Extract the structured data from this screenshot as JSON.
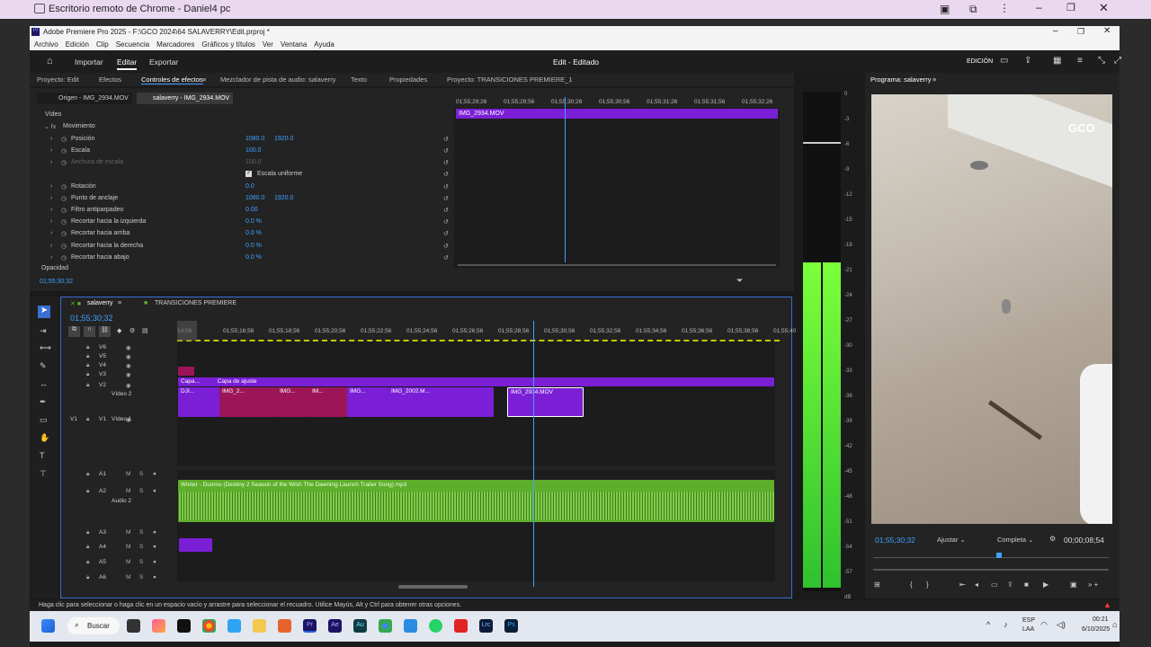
{
  "chrome": {
    "title": "Escritorio remoto de Chrome - Daniel4 pc"
  },
  "premiere": {
    "title": "Adobe Premiere Pro 2025 - F:\\GCO 2024\\64 SALAVERRY\\Edit.prproj *",
    "menu": [
      "Archivo",
      "Edición",
      "Clip",
      "Secuencia",
      "Marcadores",
      "Gráficos y títulos",
      "Ver",
      "Ventana",
      "Ayuda"
    ],
    "nav": {
      "import": "Importar",
      "edit": "Editar",
      "export": "Exportar"
    },
    "center_title": "Edit - Editado",
    "workspace": "EDICIÓN"
  },
  "panel_tabs": [
    "Proyecto: Edit",
    "Efectos",
    "Controles de efectos",
    "Mezclador de pista de audio: salaverry",
    "Texto",
    "Propiedades",
    "Proyecto: TRANSICIONES PREMIERE_1"
  ],
  "effect_controls": {
    "source_label": "Origen - IMG_2934.MOV",
    "seq_label": "salaverry - IMG_2934.MOV",
    "video_header": "Vídeo",
    "fx_name": "Movimiento",
    "rows": [
      {
        "name": "Posición",
        "v1": "1080.0",
        "v2": "1920.0"
      },
      {
        "name": "Escala",
        "v1": "100.0",
        "v2": ""
      },
      {
        "name": "Anchura de escala",
        "v1": "100.0",
        "v2": ""
      },
      {
        "name": "Escala uniforme",
        "v1": "",
        "v2": ""
      },
      {
        "name": "Rotación",
        "v1": "0.0",
        "v2": ""
      },
      {
        "name": "Punto de anclaje",
        "v1": "1080.0",
        "v2": "1920.0"
      },
      {
        "name": "Filtro antiparpadeo",
        "v1": "0.00",
        "v2": ""
      },
      {
        "name": "Recortar hacia la izquierda",
        "v1": "0.0 %",
        "v2": ""
      },
      {
        "name": "Recortar hacia arriba",
        "v1": "0.0 %",
        "v2": ""
      },
      {
        "name": "Recortar hacia la derecha",
        "v1": "0.0 %",
        "v2": ""
      },
      {
        "name": "Recortar hacia abajo",
        "v1": "0.0 %",
        "v2": ""
      }
    ],
    "opacity_label": "Opacidad",
    "timecode": "01;55;30;32",
    "ruler": [
      "01;55;29;26",
      "01;55;29;56",
      "01;55;30;26",
      "01;55;30;56",
      "01;55;31;26",
      "01;55;31;56",
      "01;55;32;26"
    ],
    "clip_name": "IMG_2934.MOV"
  },
  "timeline": {
    "seq_tab": "salaverry",
    "other_tab": "TRANSICIONES PREMIERE",
    "timecode": "01;55;30;32",
    "ruler": [
      "14;56",
      "01;55;16;56",
      "01;55;18;56",
      "01;55;20;56",
      "01;55;22;56",
      "01;55;24;56",
      "01;55;26;56",
      "01;55;28;56",
      "01;55;30;56",
      "01;55;32;56",
      "01;55;34;56",
      "01;55;36;56",
      "01;55;38;56",
      "01;55;40"
    ],
    "video_tracks": [
      "V6",
      "V5",
      "V4",
      "V3",
      "V2",
      "V1"
    ],
    "track_names": {
      "v2": "Vídeo 2",
      "v1": "Vídeo 1",
      "a2": "Audio 2"
    },
    "audio_tracks": [
      "A1",
      "A2",
      "A3",
      "A4",
      "A5",
      "A6"
    ],
    "clips": {
      "capa": "Capa...",
      "capa_ajuste": "Capa de ajuste",
      "dji": "DJI...",
      "img1": "IMG_2...",
      "img2": "IMG...",
      "img3": "IM...",
      "img4": "IMG...",
      "img5": "IMG_2002.M...",
      "img6": "IMG_2934.MOV",
      "audio": "Winter - Duomo (Destiny 2 Season of the Wish The Dawning Launch Trailer Song).mp3"
    }
  },
  "meter": {
    "scale": [
      "0",
      "-3",
      "-6",
      "-9",
      "-12",
      "-15",
      "-18",
      "-21",
      "-24",
      "-27",
      "-30",
      "-33",
      "-36",
      "-39",
      "-42",
      "-45",
      "-48",
      "-51",
      "-54",
      "-57",
      "dB"
    ],
    "level": 0.8
  },
  "program": {
    "title": "Programa: salaverry",
    "logo": "GCO",
    "timecode": "01;55;30;32",
    "fit": "Ajustar",
    "quality": "Completa",
    "duration": "00;00;08;54"
  },
  "status": "Haga clic para seleccionar o haga clic en un espacio vacío y arrastre para seleccionar el recuadro. Utilice Mayús, Alt y Ctrl para obtener otras opciones.",
  "taskbar": {
    "search": "Buscar",
    "lang1": "ESP",
    "lang2": "LAA",
    "time": "00:21",
    "date": "6/10/2025"
  },
  "colors": {
    "accent": "#3fa2ff",
    "clip_purple": "#7a1fd6",
    "clip_pink": "#9c1558",
    "audio_green": "#5fae2b"
  }
}
